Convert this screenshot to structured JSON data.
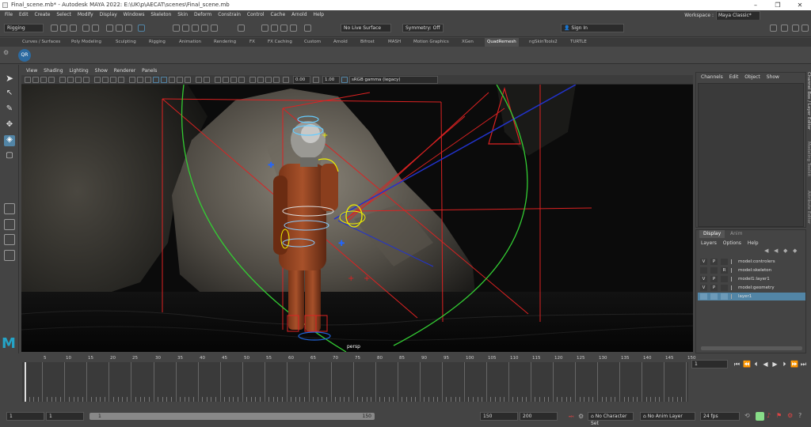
{
  "window": {
    "title": "Final_scene.mb* - Autodesk MAYA 2022: E:\\UK\\p\\AECAT\\scenes\\Final_scene.mb"
  },
  "menubar": {
    "items": [
      "File",
      "Edit",
      "Create",
      "Select",
      "Modify",
      "Display",
      "Windows",
      "Skeleton",
      "Skin",
      "Deform",
      "Constrain",
      "Control",
      "Cache",
      "Arnold",
      "Help"
    ],
    "workspace_label": "Workspace :",
    "workspace_value": "Maya Classic*"
  },
  "statusline": {
    "menuset": "Rigging",
    "live_surface": "No Live Surface",
    "symmetry": "Symmetry: Off",
    "sign_in": "Sign In"
  },
  "shelf": {
    "tabs": [
      "Curves / Surfaces",
      "Poly Modeling",
      "Sculpting",
      "Rigging",
      "Animation",
      "Rendering",
      "FX",
      "FX Caching",
      "Custom",
      "Arnold",
      "Bifrost",
      "MASH",
      "Motion Graphics",
      "XGen",
      "QuadRemesh",
      "ngSkinTools2",
      "TURTLE"
    ],
    "active_tab": "QuadRemesh",
    "qr_button": "QR"
  },
  "viewport": {
    "menu": [
      "View",
      "Shading",
      "Lighting",
      "Show",
      "Renderer",
      "Panels"
    ],
    "exposure": "0.00",
    "gamma": "1.00",
    "color_space": "sRGB gamma (legacy)",
    "camera": "persp"
  },
  "channelbox": {
    "menu": [
      "Channels",
      "Edit",
      "Object",
      "Show"
    ]
  },
  "side_tabs": [
    "Channel Box / Layer Editor",
    "Modeling Toolkit",
    "Attribute Editor"
  ],
  "layer_editor": {
    "tabs": [
      "Display",
      "Anim"
    ],
    "menu": [
      "Layers",
      "Options",
      "Help"
    ],
    "layers": [
      {
        "v": "V",
        "p": "P",
        "r": "",
        "name": "model:controlers",
        "selected": false
      },
      {
        "v": "",
        "p": "",
        "r": "R",
        "name": "model:skeleton",
        "selected": false
      },
      {
        "v": "V",
        "p": "P",
        "r": "",
        "name": "model1:layer1",
        "selected": false
      },
      {
        "v": "V",
        "p": "P",
        "r": "",
        "name": "model:geometry",
        "selected": false
      },
      {
        "v": "",
        "p": "",
        "r": "",
        "name": "layer1",
        "selected": true
      }
    ]
  },
  "timeslider": {
    "ticks": [
      "5",
      "10",
      "15",
      "20",
      "25",
      "30",
      "35",
      "40",
      "45",
      "50",
      "55",
      "60",
      "65",
      "70",
      "75",
      "80",
      "85",
      "90",
      "95",
      "100",
      "105",
      "110",
      "115",
      "120",
      "125",
      "130",
      "135",
      "140",
      "145",
      "150"
    ],
    "current_frame": "1"
  },
  "rangebar": {
    "start": "1",
    "anim_start": "1",
    "range_inner_start": "1",
    "range_inner_end": "150",
    "range_end": "150",
    "anim_end": "200",
    "character_set": "No Character Set",
    "anim_layer": "No Anim Layer",
    "fps": "24 fps"
  },
  "colors": {
    "selected_layer": "#5285a6",
    "logo": "#25a4c7",
    "accent": "#5285a6"
  }
}
